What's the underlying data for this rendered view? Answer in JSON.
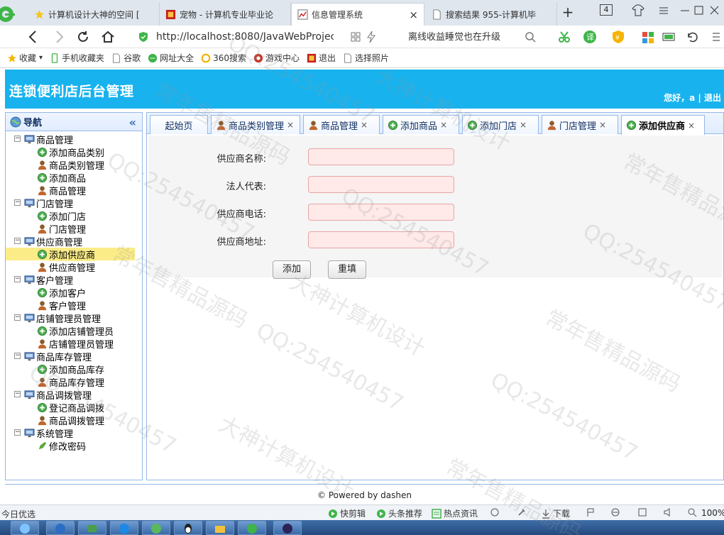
{
  "browser": {
    "tabs": [
      {
        "title": "计算机设计大神的空间 [",
        "active": false
      },
      {
        "title": "宠物 - 计算机专业毕业论",
        "active": false
      },
      {
        "title": "信息管理系统",
        "active": true
      },
      {
        "title": "搜索结果 955-计算机毕",
        "active": false
      }
    ],
    "tab_count": "4",
    "url": "http://localhost:8080/JavaWebProjec",
    "search_text": "离线收益睡觉也在升级",
    "bookmarks": [
      "收藏",
      "手机收藏夹",
      "谷歌",
      "网址大全",
      "360搜索",
      "游戏中心",
      "退出",
      "选择照片"
    ]
  },
  "app": {
    "title": "连锁便利店后台管理",
    "greeting": "您好，a",
    "logout": "退出"
  },
  "sidebar": {
    "title": "导航",
    "groups": [
      {
        "label": "商品管理",
        "items": [
          "添加商品类别",
          "商品类别管理",
          "添加商品",
          "商品管理"
        ]
      },
      {
        "label": "门店管理",
        "items": [
          "添加门店",
          "门店管理"
        ]
      },
      {
        "label": "供应商管理",
        "items": [
          "添加供应商",
          "供应商管理"
        ]
      },
      {
        "label": "客户管理",
        "items": [
          "添加客户",
          "客户管理"
        ]
      },
      {
        "label": "店铺管理员管理",
        "items": [
          "添加店铺管理员",
          "店铺管理员管理"
        ]
      },
      {
        "label": "商品库存管理",
        "items": [
          "添加商品库存",
          "商品库存管理"
        ]
      },
      {
        "label": "商品调拨管理",
        "items": [
          "登记商品调拨",
          "商品调拨管理"
        ]
      },
      {
        "label": "系统管理",
        "items": [
          "修改密码"
        ]
      }
    ],
    "selected": "添加供应商"
  },
  "content_tabs": [
    "起始页",
    "商品类别管理",
    "商品管理",
    "添加商品",
    "添加门店",
    "门店管理",
    "添加供应商"
  ],
  "form": {
    "fields": [
      {
        "label": "供应商名称:",
        "value": ""
      },
      {
        "label": "法人代表:",
        "value": ""
      },
      {
        "label": "供应商电话:",
        "value": ""
      },
      {
        "label": "供应商地址:",
        "value": ""
      }
    ],
    "submit_label": "添加",
    "reset_label": "重填"
  },
  "footer": {
    "text": "© Powered by dashen"
  },
  "statusbar": {
    "left": "今日优选",
    "items": [
      "快剪辑",
      "头条推荐",
      "热点资讯",
      "下载"
    ],
    "zoom": "100%"
  },
  "watermark": {
    "texts": [
      "大神计算机设计",
      "QQ:254540457",
      "常年售精品源码"
    ]
  },
  "colors": {
    "header": "#18b3ef",
    "panel_border": "#95b8e7",
    "selected_item": "#fbec88",
    "input_bg": "#ffe9e9"
  }
}
